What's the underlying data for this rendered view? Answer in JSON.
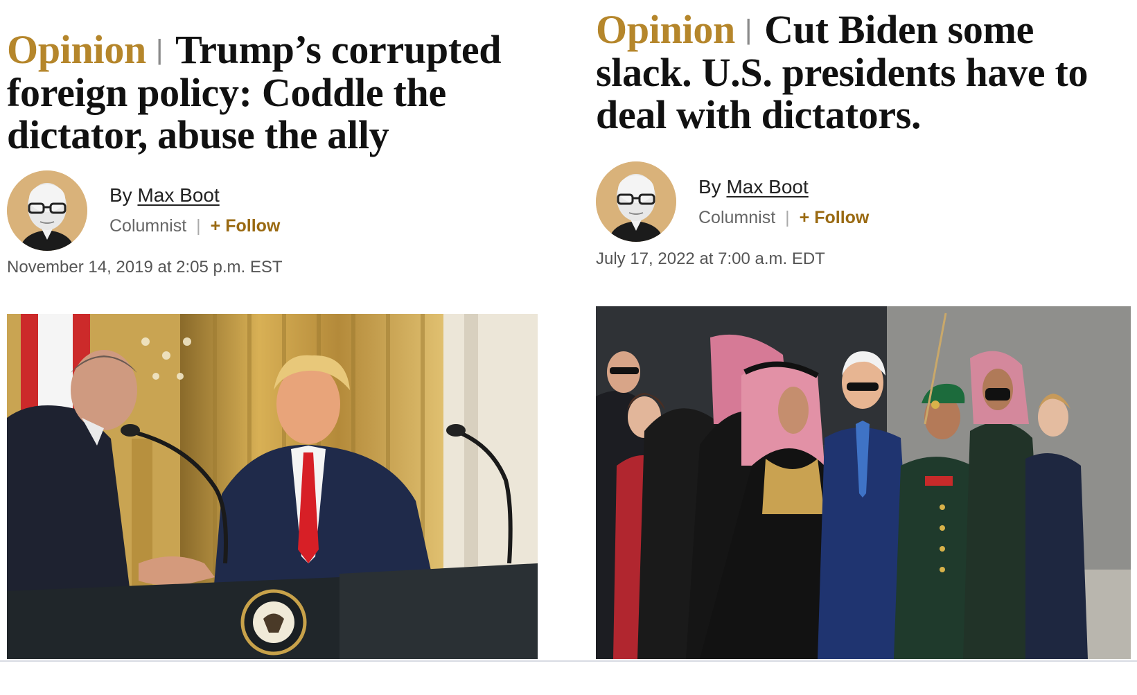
{
  "articles": [
    {
      "kicker": "Opinion",
      "headline": "Trump’s corrupted foreign policy: Coddle the dictator, abuse the ally",
      "byline_prefix": "By",
      "author": "Max Boot",
      "role": "Columnist",
      "follow_label": "+ Follow",
      "date": "November 14, 2019 at 2:05 p.m. EST",
      "photo_icon": "press-conference-photo"
    },
    {
      "kicker": "Opinion",
      "headline": "Cut Biden some slack. U.S. presidents have to deal with dictators.",
      "byline_prefix": "By",
      "author": "Max Boot",
      "role": "Columnist",
      "follow_label": "+ Follow",
      "date": "July 17, 2022 at 7:00 a.m. EDT",
      "photo_icon": "arrival-ceremony-photo"
    }
  ],
  "colors": {
    "kicker": "#b5862b",
    "follow": "#9a6a12",
    "avatar_bg": "#d9b27a"
  }
}
